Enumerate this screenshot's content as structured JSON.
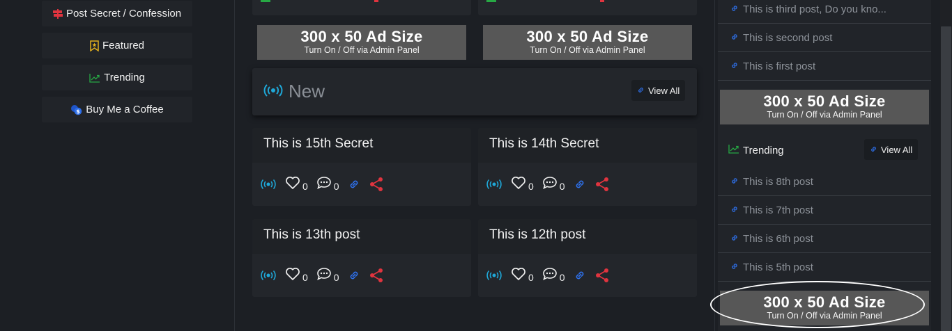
{
  "left_nav": [
    {
      "label": "Post Secret / Confession",
      "icon": "signpost-icon",
      "color": "#e0343f"
    },
    {
      "label": "Featured",
      "icon": "bookmark-star-icon",
      "color": "#e5b21d"
    },
    {
      "label": "Trending",
      "icon": "trending-icon",
      "color": "#27a844"
    },
    {
      "label": "Buy Me a Coffee",
      "icon": "coins-icon",
      "color": "#2e6fe8"
    }
  ],
  "ads": {
    "big": "300 x 50 Ad Size",
    "small": "Turn On / Off via Admin Panel"
  },
  "new_section": {
    "title": "New",
    "view_all": "View All",
    "accent": "#1fa8d8"
  },
  "posts": [
    {
      "title": "This is 15th Secret",
      "likes": "0",
      "comments": "0"
    },
    {
      "title": "This is 14th Secret",
      "likes": "0",
      "comments": "0"
    },
    {
      "title": "This is 13th post",
      "likes": "0",
      "comments": "0"
    },
    {
      "title": "This is 12th post",
      "likes": "0",
      "comments": "0"
    }
  ],
  "right_sidebar": {
    "recent_links": [
      "This is third post, Do you kno...",
      "This is second post",
      "This is first post"
    ],
    "trending": {
      "title": "Trending",
      "view_all": "View All",
      "links": [
        "This is 8th post",
        "This is 7th post",
        "This is 6th post",
        "This is 5th post"
      ]
    }
  },
  "colors": {
    "link_blue": "#2e6fe8",
    "share_red": "#e0343f",
    "trend_green": "#27a844"
  }
}
